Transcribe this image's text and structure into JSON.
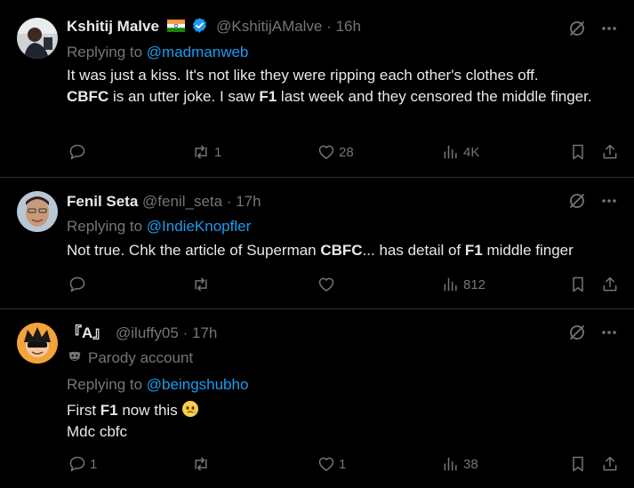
{
  "tweets": [
    {
      "name": "Kshitij Malve",
      "handle": "@KshitijAMalve",
      "sep": "·",
      "time": "16h",
      "replying_prefix": "Replying to",
      "replying_to": "@madmanweb",
      "text_parts": [
        "It was just a kiss. It's not like they were ripping each other's clothes off.",
        "CBFC",
        " is an utter joke. I saw ",
        "F1",
        " last week and they censored the middle finger."
      ],
      "actions": {
        "reply": "",
        "retweet": "1",
        "like": "28",
        "views": "4K"
      },
      "badges": {
        "flag": "india-flag-icon",
        "verified": "verified-badge-icon"
      }
    },
    {
      "name": "Fenil Seta",
      "handle": "@fenil_seta",
      "sep": "·",
      "time": "17h",
      "replying_prefix": "Replying to",
      "replying_to": "@IndieKnopfler",
      "text_parts": [
        "Not true. Chk the article of Superman ",
        "CBFC",
        "... has detail of ",
        "F1",
        " middle finger"
      ],
      "actions": {
        "reply": "",
        "retweet": "",
        "like": "",
        "views": "812"
      }
    },
    {
      "name": "『A』",
      "handle": "@iluffy05",
      "sep": "·",
      "time": "17h",
      "parody_label": "Parody account",
      "replying_prefix": "Replying to",
      "replying_to": "@beingshubho",
      "text_parts": [
        "First ",
        "F1",
        " now this",
        "Mdc cbfc"
      ],
      "actions": {
        "reply": "1",
        "retweet": "",
        "like": "1",
        "views": "38"
      }
    }
  ],
  "colors": {
    "background": "#000000",
    "text": "#e7e9ea",
    "muted": "#71767b",
    "link": "#1d9bf0",
    "divider": "#2f3336",
    "verified": "#1d9bf0"
  }
}
